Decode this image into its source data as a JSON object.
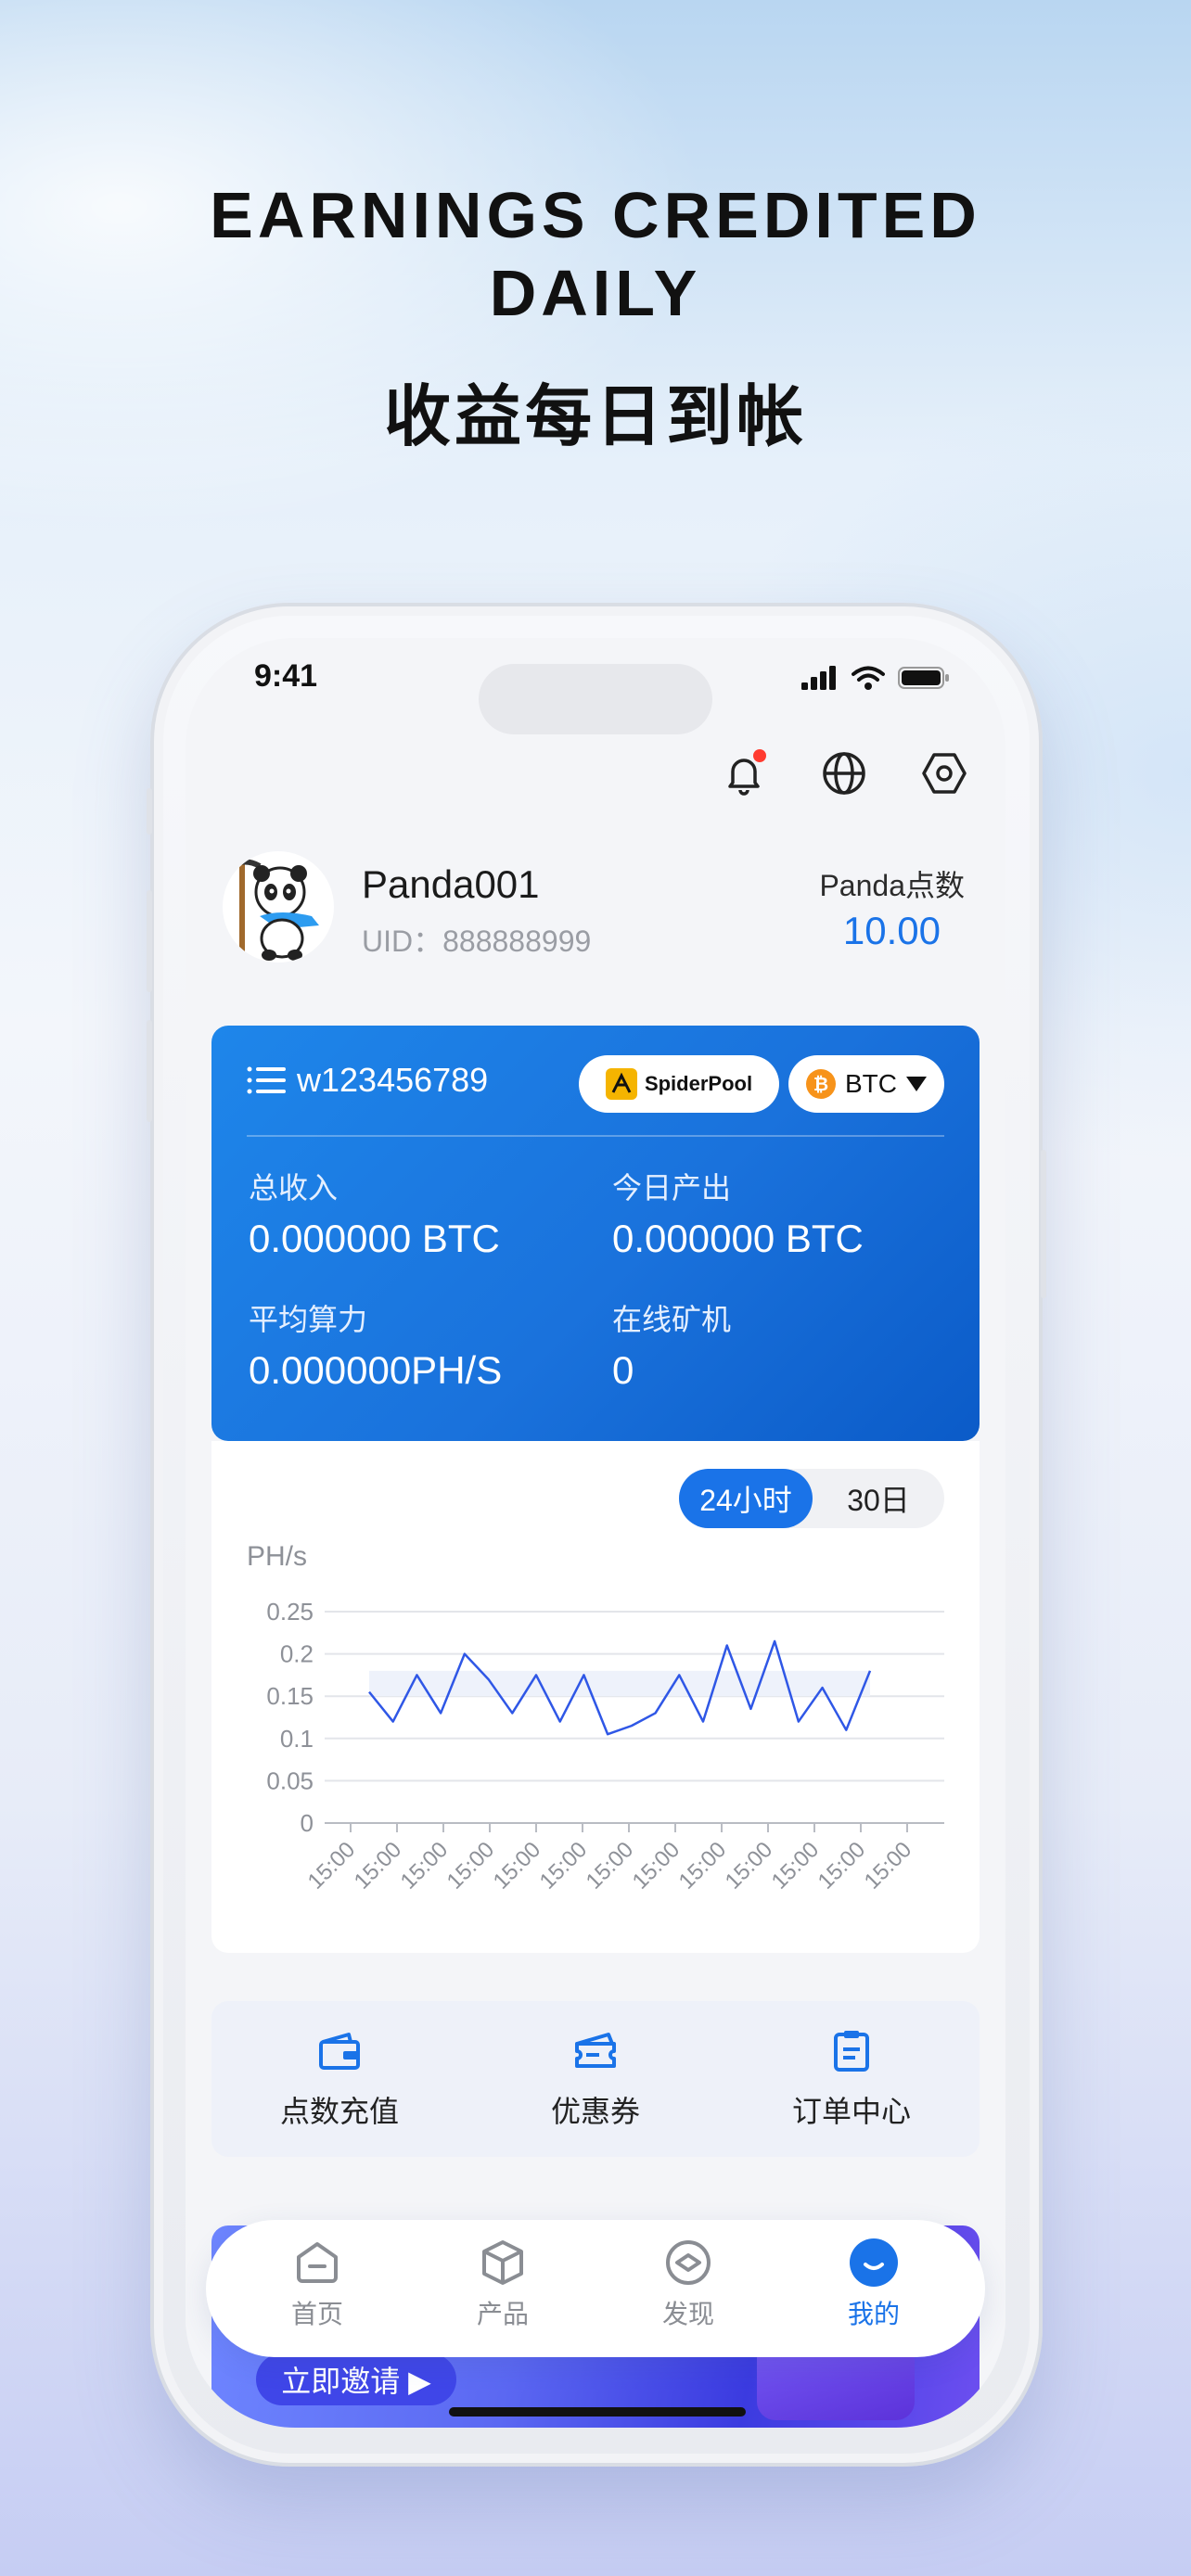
{
  "headline": {
    "en": "EARNINGS CREDITED\nDAILY",
    "en_line1": "EARNINGS CREDITED",
    "en_line2": "DAILY",
    "cn": "收益每日到帐"
  },
  "status_bar": {
    "time": "9:41"
  },
  "top_icons": [
    "bell-icon",
    "globe-icon",
    "settings-icon"
  ],
  "profile": {
    "name": "Panda001",
    "uid": "UID：888888999",
    "points_label": "Panda点数",
    "points_value": "10.00"
  },
  "account_card": {
    "account": "w123456789",
    "pool": "SpiderPool",
    "coin": "BTC",
    "stats": [
      {
        "label": "总收入",
        "value": "0.000000 BTC"
      },
      {
        "label": "今日产出",
        "value": "0.000000 BTC"
      },
      {
        "label": "平均算力",
        "value": "0.000000PH/S"
      },
      {
        "label": "在线矿机",
        "value": "0"
      }
    ]
  },
  "range_toggle": {
    "active": "24小时",
    "inactive": "30日"
  },
  "chart_data": {
    "type": "line",
    "ylabel": "PH/s",
    "ylim": [
      0,
      0.25
    ],
    "yticks": [
      "0",
      "0.05",
      "0.1",
      "0.15",
      "0.2",
      "0.25"
    ],
    "xticks": [
      "15:00",
      "15:00",
      "15:00",
      "15:00",
      "15:00",
      "15:00",
      "15:00",
      "15:00",
      "15:00",
      "15:00",
      "15:00",
      "15:00",
      "15:00"
    ],
    "series": [
      {
        "values": [
          0.155,
          0.12,
          0.175,
          0.13,
          0.2,
          0.17,
          0.13,
          0.175,
          0.12,
          0.175,
          0.105,
          0.115,
          0.13,
          0.175,
          0.12,
          0.21,
          0.135,
          0.215,
          0.12,
          0.16,
          0.11,
          0.18
        ],
        "color": "#2f57e6"
      }
    ]
  },
  "quick_actions": [
    {
      "label": "点数充值",
      "icon": "wallet-icon"
    },
    {
      "label": "优惠券",
      "icon": "coupon-icon"
    },
    {
      "label": "订单中心",
      "icon": "clipboard-icon"
    }
  ],
  "banner": {
    "cta": "立即邀请 ▶"
  },
  "tabbar": [
    {
      "label": "首页",
      "icon": "home-icon"
    },
    {
      "label": "产品",
      "icon": "box-icon"
    },
    {
      "label": "发现",
      "icon": "compass-icon"
    },
    {
      "label": "我的",
      "icon": "profile-icon",
      "active": true
    }
  ],
  "colors": {
    "accent": "#1a73e8",
    "card_blue": "#1a72dc",
    "line": "#2f57e6"
  }
}
